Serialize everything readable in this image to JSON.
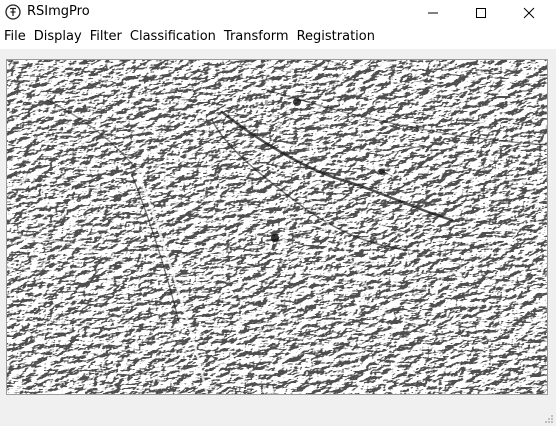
{
  "window": {
    "title": "RSImgPro",
    "app_icon": "rs-logo-icon"
  },
  "title_buttons": {
    "minimize_icon": "minimize-icon",
    "maximize_icon": "maximize-icon",
    "close_icon": "close-icon"
  },
  "menu": {
    "items": [
      {
        "label": "File"
      },
      {
        "label": "Display"
      },
      {
        "label": "Filter"
      },
      {
        "label": "Classification"
      },
      {
        "label": "Transform"
      },
      {
        "label": "Registration"
      }
    ]
  },
  "image_view": {
    "content": "embossed-terrain-image"
  },
  "colors": {
    "titlebar_bg": "#ffffff",
    "menubar_bg": "#ffffff",
    "client_bg": "#f0f0f0",
    "image_light": "#ffffff",
    "image_dark": "#1a1a1a",
    "image_mid": "#8c8c8c"
  }
}
